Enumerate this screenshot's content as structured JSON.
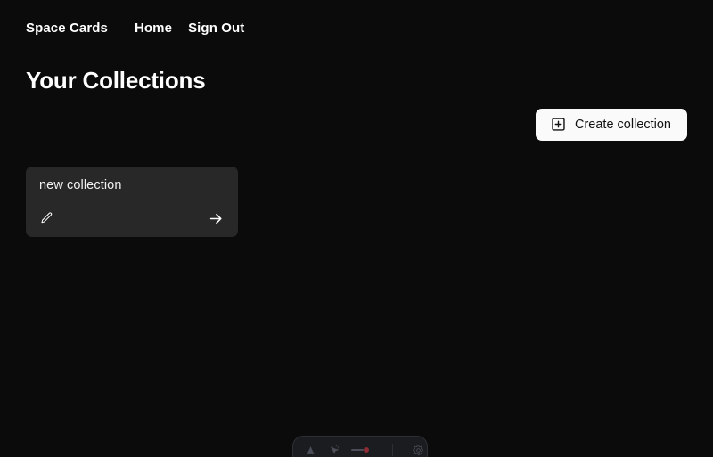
{
  "nav": {
    "brand": "Space Cards",
    "links": [
      {
        "label": "Home",
        "name": "nav-link-home"
      },
      {
        "label": "Sign Out",
        "name": "nav-link-sign-out"
      }
    ]
  },
  "page": {
    "title": "Your Collections"
  },
  "actions": {
    "create_collection_label": "Create collection",
    "create_collection_icon": "plus-square-icon"
  },
  "collections": [
    {
      "title": "new collection",
      "edit_icon": "pencil-icon",
      "open_icon": "arrow-right-icon"
    }
  ],
  "dev_toolbar": {
    "icons": [
      "text-cursor-icon",
      "pointer-click-icon",
      "record-slider-icon",
      "gear-icon"
    ]
  },
  "colors": {
    "page_background": "#0b0b0b",
    "card_background": "#282828",
    "accent_button_background": "#fafafa",
    "accent_button_text": "#111111",
    "text_primary": "#ffffff",
    "record_dot": "#8c2b33"
  }
}
